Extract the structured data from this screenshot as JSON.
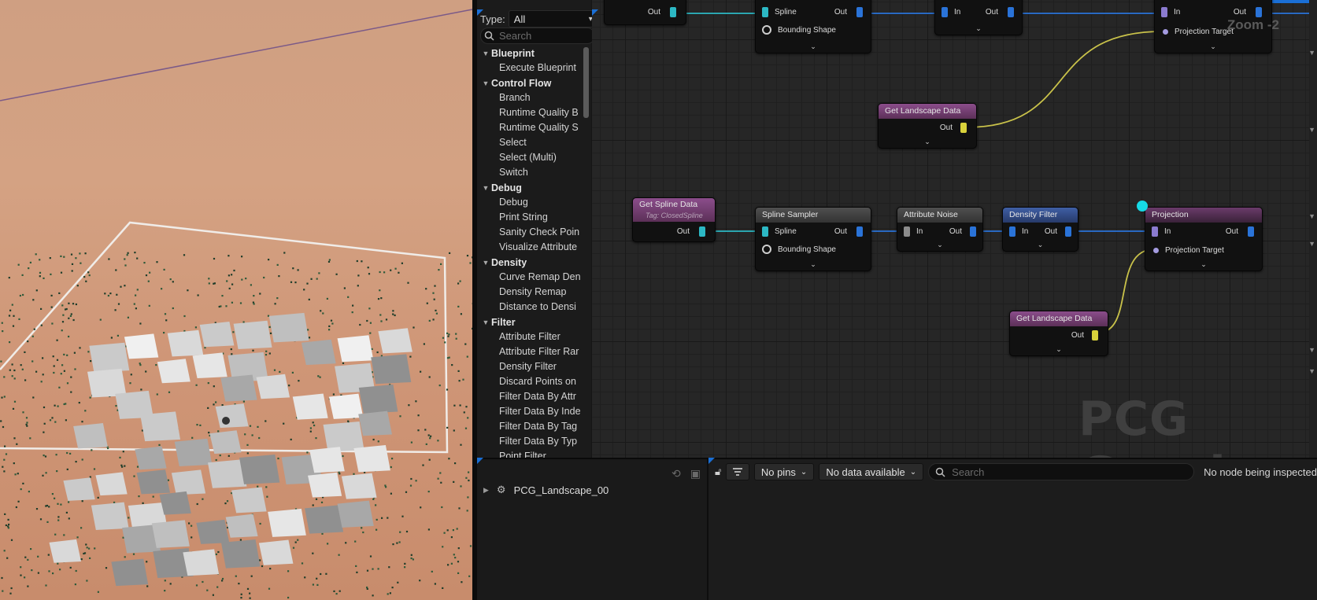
{
  "palette": {
    "type_label": "Type:",
    "type_value": "All",
    "search_placeholder": "Search",
    "categories": [
      {
        "name": "Blueprint",
        "items": [
          "Execute Blueprint"
        ]
      },
      {
        "name": "Control Flow",
        "items": [
          "Branch",
          "Runtime Quality B",
          "Runtime Quality S",
          "Select",
          "Select (Multi)",
          "Switch"
        ]
      },
      {
        "name": "Debug",
        "items": [
          "Debug",
          "Print String",
          "Sanity Check Poin",
          "Visualize Attribute"
        ]
      },
      {
        "name": "Density",
        "items": [
          "Curve Remap Den",
          "Density Remap",
          "Distance to Densi"
        ]
      },
      {
        "name": "Filter",
        "items": [
          "Attribute Filter",
          "Attribute Filter Rar",
          "Density Filter",
          "Discard Points on",
          "Filter Data By Attr",
          "Filter Data By Inde",
          "Filter Data By Tag",
          "Filter Data By Typ",
          "Point Filter"
        ]
      }
    ]
  },
  "graph": {
    "zoom_label": "Zoom -2",
    "watermark": "PCG Graph",
    "pin_labels": {
      "out": "Out",
      "in": "In",
      "spline": "Spline",
      "bounding_shape": "Bounding Shape",
      "projection_target": "Projection Target"
    },
    "nodes": {
      "get_spline_data": {
        "title": "Get Spline Data",
        "subtitle": "Tag: ClosedSpline"
      },
      "spline_sampler": {
        "title": "Spline Sampler"
      },
      "attribute_noise": {
        "title": "Attribute Noise"
      },
      "density_filter": {
        "title": "Density Filter"
      },
      "projection": {
        "title": "Projection"
      },
      "get_landscape_data_top": {
        "title": "Get Landscape Data"
      },
      "get_landscape_data_bottom": {
        "title": "Get Landscape Data"
      }
    },
    "chevron": "⌄"
  },
  "inspector": {
    "outline_item": "PCG_Landscape_00",
    "pins_dropdown": "No pins",
    "data_dropdown": "No data available",
    "search_placeholder": "Search",
    "status": "No node being inspected"
  },
  "colors": {
    "accent": "#1a6fd6",
    "wire_point": "#2a73d8",
    "wire_spline": "#2cb8c4",
    "wire_landscape": "#c9c24a",
    "selection_dot": "#16d9e6"
  }
}
